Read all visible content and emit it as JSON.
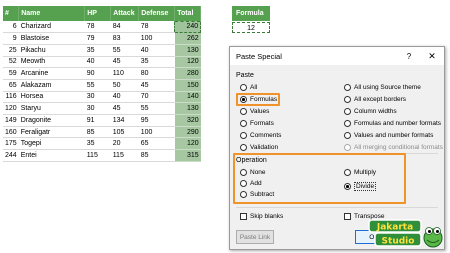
{
  "sheet": {
    "headers": [
      "#",
      "Name",
      "HP",
      "Attack",
      "Defense",
      "Total"
    ],
    "rows": [
      [
        "6",
        "Charizard",
        "78",
        "84",
        "78",
        "240"
      ],
      [
        "9",
        "Blastoise",
        "79",
        "83",
        "100",
        "262"
      ],
      [
        "25",
        "Pikachu",
        "35",
        "55",
        "40",
        "130"
      ],
      [
        "52",
        "Meowth",
        "40",
        "45",
        "35",
        "120"
      ],
      [
        "59",
        "Arcanine",
        "90",
        "110",
        "80",
        "280"
      ],
      [
        "65",
        "Alakazam",
        "55",
        "50",
        "45",
        "150"
      ],
      [
        "116",
        "Horsea",
        "30",
        "40",
        "70",
        "140"
      ],
      [
        "120",
        "Staryu",
        "30",
        "45",
        "55",
        "130"
      ],
      [
        "149",
        "Dragonite",
        "91",
        "134",
        "95",
        "320"
      ],
      [
        "160",
        "Feraligatr",
        "85",
        "105",
        "100",
        "290"
      ],
      [
        "175",
        "Togepi",
        "35",
        "20",
        "65",
        "120"
      ],
      [
        "244",
        "Entei",
        "115",
        "115",
        "85",
        "315"
      ]
    ]
  },
  "formula": {
    "header": "Formula",
    "value": "12"
  },
  "dialog": {
    "title": "Paste Special",
    "help": "?",
    "close": "✕",
    "paste_label": "Paste",
    "paste_left": [
      "All",
      "Formulas",
      "Values",
      "Formats",
      "Comments",
      "Validation"
    ],
    "paste_right": [
      "All using Source theme",
      "All except borders",
      "Column widths",
      "Formulas and number formats",
      "Values and number formats",
      "All merging conditional formats"
    ],
    "selected_paste": "Formulas",
    "operation_label": "Operation",
    "operation_left": [
      "None",
      "Add",
      "Subtract"
    ],
    "operation_right": [
      "Multiply",
      "Divide"
    ],
    "selected_operation": "Divide",
    "skip_blanks": "Skip blanks",
    "transpose": "Transpose",
    "paste_link": "Paste Link",
    "ok": "OK"
  },
  "logo": {
    "line1": "Jakarta",
    "line2": "Studio"
  },
  "colors": {
    "header_green": "#55a14f",
    "total_green": "#a6c7a2",
    "highlight": "#f0932b",
    "ok_blue": "#1f6fd1"
  }
}
